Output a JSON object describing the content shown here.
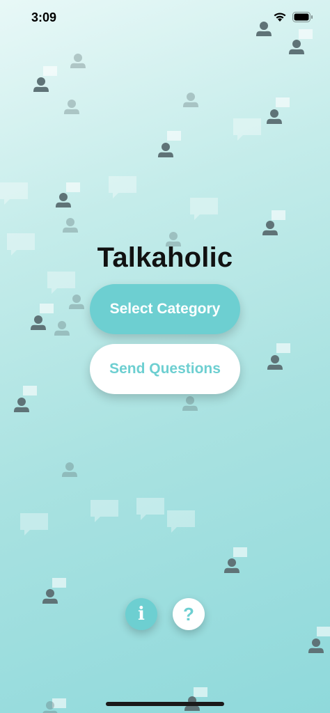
{
  "status_bar": {
    "time": "3:09"
  },
  "app": {
    "title": "Talkaholic",
    "select_category_label": "Select Category",
    "send_questions_label": "Send Questions",
    "info_glyph": "i",
    "help_glyph": "?"
  },
  "colors": {
    "accent": "#6dcfd1",
    "background_top": "#e8f8f7",
    "background_bottom": "#8fd9db",
    "person_icon": "#5f7377"
  },
  "icons": [
    "wifi-icon",
    "battery-icon",
    "person-icon",
    "speech-bubble-icon",
    "info-icon",
    "question-icon"
  ]
}
